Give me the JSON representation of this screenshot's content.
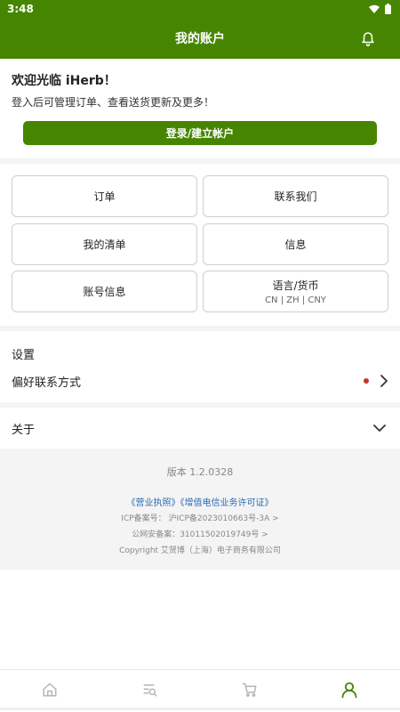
{
  "status": {
    "time": "3:48"
  },
  "header": {
    "title": "我的账户"
  },
  "welcome": {
    "title": "欢迎光临 iHerb！",
    "subtitle": "登入后可管理订单、查看送货更新及更多！",
    "login_button": "登录/建立帐户"
  },
  "tiles": {
    "orders": "订单",
    "contact": "联系我们",
    "lists": "我的清单",
    "messages": "信息",
    "account_info": "账号信息",
    "language": "语言/货币",
    "language_value": "CN | ZH | CNY"
  },
  "settings": {
    "label": "设置",
    "preferences": "偏好联系方式"
  },
  "about": {
    "label": "关于"
  },
  "footer": {
    "version": "版本 1.2.0328",
    "license_link": "《营业执照》",
    "telecom_link": "《增值电信业务许可证》",
    "icp": "ICP备案号： 沪ICP备2023010663号-3A >",
    "public_security": "公网安备案：31011502019749号 >",
    "copyright": "Copyright 艾贺博（上海）电子商务有限公司"
  },
  "colors": {
    "brand": "#458500",
    "alert_dot": "#c0392b",
    "link": "#2a6bb5"
  },
  "tabbar": {
    "icons": [
      "home-icon",
      "search-list-icon",
      "cart-icon",
      "account-icon"
    ],
    "active": "account-icon"
  }
}
